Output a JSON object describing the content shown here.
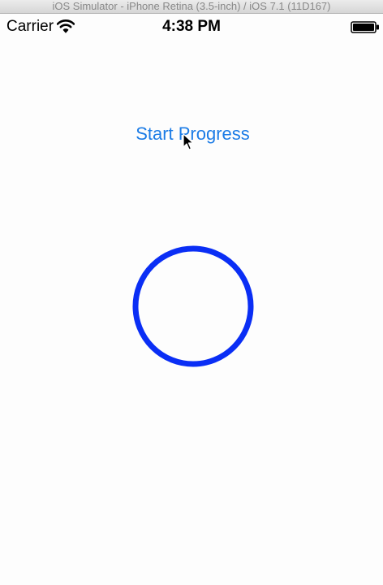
{
  "window": {
    "title": "iOS Simulator - iPhone Retina (3.5-inch) / iOS 7.1 (11D167)"
  },
  "status_bar": {
    "carrier": "Carrier",
    "time": "4:38 PM",
    "wifi_icon": "wifi-icon",
    "battery_icon": "battery-icon"
  },
  "main": {
    "start_button_label": "Start Progress",
    "progress_ring": {
      "color": "#0a2ef5",
      "progress": 0
    }
  },
  "colors": {
    "accent": "#1c7ce6",
    "ring": "#0a2ef5"
  }
}
